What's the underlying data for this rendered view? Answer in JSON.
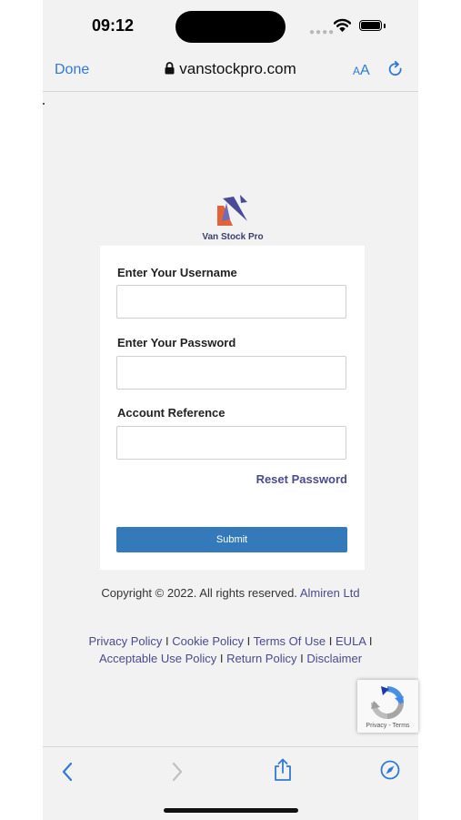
{
  "status_bar": {
    "time": "09:12"
  },
  "browser": {
    "done_label": "Done",
    "url": "vanstockpro.com",
    "text_size_small": "A",
    "text_size_large": "A"
  },
  "logo": {
    "text": "Van Stock Pro"
  },
  "login_form": {
    "username_label": "Enter Your Username",
    "username_value": "",
    "password_label": "Enter Your Password",
    "password_value": "",
    "account_label": "Account Reference",
    "account_value": "",
    "reset_password": "Reset Password",
    "submit_label": "Submit"
  },
  "footer": {
    "copyright_text": "Copyright © 2022. All rights reserved.",
    "company_link": "Almiren Ltd",
    "links_row1": [
      "Privacy Policy",
      "Cookie Policy",
      "Terms Of Use",
      "EULA"
    ],
    "links_row2": [
      "Acceptable Use Policy",
      "Return Policy",
      "Disclaimer"
    ],
    "separator": "I"
  },
  "recaptcha": {
    "privacy": "Privacy",
    "dash": "-",
    "terms": "Terms"
  },
  "colors": {
    "accent_blue": "#2f7ad8",
    "submit_blue": "#3479b9",
    "link_purple": "#4a4a8e",
    "logo_orange": "#e0633a",
    "logo_purple": "#4b4a96"
  },
  "icons": {
    "back": "chevron-left-icon",
    "forward": "chevron-right-icon",
    "share": "share-icon",
    "safari": "compass-icon",
    "lock": "lock-icon",
    "reload": "reload-icon"
  }
}
